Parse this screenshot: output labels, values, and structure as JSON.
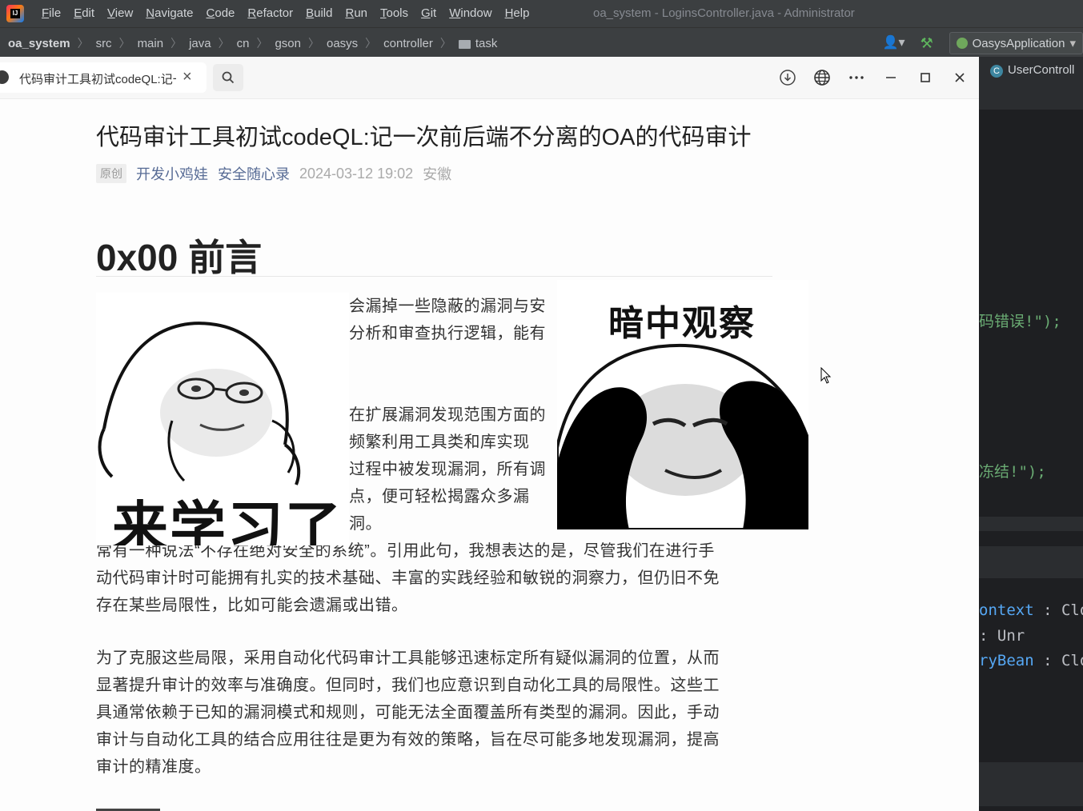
{
  "ide": {
    "menu": [
      "File",
      "Edit",
      "View",
      "Navigate",
      "Code",
      "Refactor",
      "Build",
      "Run",
      "Tools",
      "Git",
      "Window",
      "Help"
    ],
    "window_title": "oa_system - LoginsController.java - Administrator",
    "breadcrumb": [
      "oa_system",
      "src",
      "main",
      "java",
      "cn",
      "gson",
      "oasys",
      "controller",
      "task"
    ],
    "run_config": "OasysApplication",
    "editor_tab": "UserControll",
    "code_fragments": {
      "line1": "码错误!\");",
      "line2": "冻结!\");",
      "line3_a": "ontext",
      "line3_b": " : Clo",
      "line4_b": " : Unr",
      "line5_a": "ryBean",
      "line5_b": " : Clo"
    },
    "colors": {
      "string": "#6aab73",
      "punct": "#bcbec4",
      "field": "#56a8f5",
      "semicolon": "#cf8e6d"
    }
  },
  "reader": {
    "tab_title": "代码审计工具初试codeQL:记一次前后端不分离的OA的代码审计",
    "close_glyph": "×",
    "article": {
      "title": "代码审计工具初试codeQL:记一次前后端不分离的OA的代码审计",
      "badge": "原创",
      "author": "开发小鸡娃",
      "account": "安全随心录",
      "date": "2024-03-12 19:02",
      "location": "安徽",
      "heading": "0x00 前言",
      "para1_lines": [
        "会漏掉一些隐蔽的漏洞与安",
        "分析和审查执行逻辑，能有"
      ],
      "para2_lines": [
        "在扩展漏洞发现范围方面的",
        "频繁利用工具类和库实现",
        "过程中被发现漏洞，所有调",
        "点，便可轻松揭露众多漏洞。"
      ],
      "para3_lines": [
        "常有一种说法“不存在绝对安全的系统”。引用此句，我想表达的是，尽管我们在进行手",
        "动代码审计时可能拥有扎实的技术基础、丰富的实践经验和敏锐的洞察力，但仍旧不免",
        "存在某些局限性，比如可能会遗漏或出错。"
      ],
      "para4_lines": [
        "为了克服这些局限，采用自动化代码审计工具能够迅速标定所有疑似漏洞的位置，从而",
        "显著提升审计的效率与准确度。但同时，我们也应意识到自动化工具的局限性。这些工",
        "具通常依赖于已知的漏洞模式和规则，可能无法全面覆盖所有类型的漏洞。因此，手动",
        "审计与自动化工具的结合应用往往是更为有效的策略，旨在尽可能多地发现漏洞，提高",
        "审计的精准度。"
      ]
    },
    "stickers": {
      "left_caption": "来学习了",
      "right_caption": "暗中观察"
    }
  }
}
